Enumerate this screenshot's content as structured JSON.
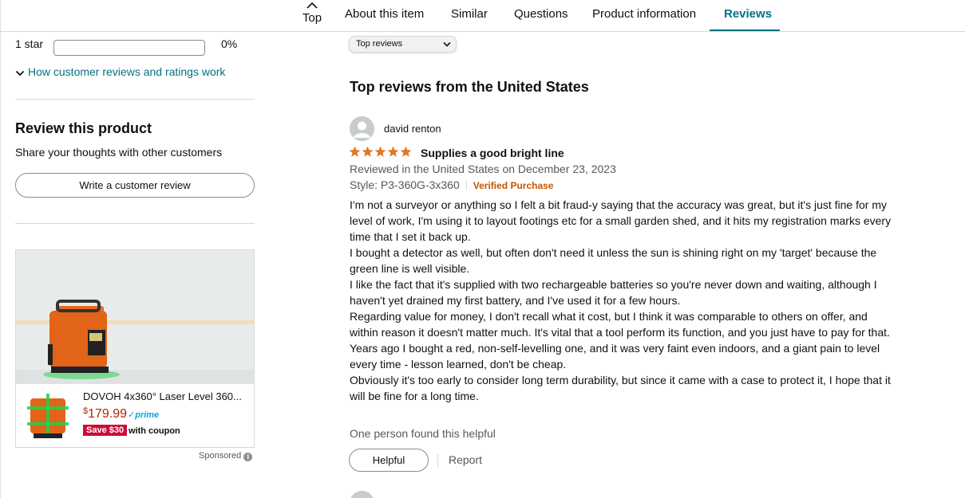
{
  "nav": {
    "top_label": "Top",
    "tabs": [
      {
        "label": "About this item"
      },
      {
        "label": "Similar"
      },
      {
        "label": "Questions"
      },
      {
        "label": "Product information"
      },
      {
        "label": "Reviews"
      }
    ],
    "active_tab": "Reviews",
    "accent_color": "#007185"
  },
  "ratings": {
    "one_star": {
      "label": "1 star",
      "percent_text": "0%",
      "fill_fraction": 0
    }
  },
  "how_link": "How customer reviews and ratings work",
  "review_product": {
    "title": "Review this product",
    "subtitle": "Share your thoughts with other customers",
    "button": "Write a customer review"
  },
  "ad": {
    "title": "DOVOH 4x360° Laser Level 360...",
    "price_symbol": "$",
    "price": "179.99",
    "prime": "prime",
    "save_badge": "Save $30",
    "coupon": "with coupon",
    "sponsored": "Sponsored",
    "save_color": "#cc0c39",
    "price_color": "#b12704"
  },
  "sort": {
    "selected": "Top reviews"
  },
  "section_title": "Top reviews from the United States",
  "review": {
    "author": "david renton",
    "rating": 5,
    "headline": "Supplies a good bright line",
    "date": "Reviewed in the United States on December 23, 2023",
    "style": "Style: P3-360G-3x360",
    "verified": "Verified Purchase",
    "body": [
      "I'm not a surveyor or anything so I felt a bit fraud-y saying that the accuracy was great, but it's just fine for my level of work, I'm using it to layout footings etc for a small garden shed, and it hits my registration marks every time that I set it back up.",
      "I bought a detector as well, but often don't need it unless the sun is shining right on my 'target' because the green line is well visible.",
      "I like the fact that it's supplied with two rechargeable batteries so you're never down and waiting, although I haven't yet drained my first battery, and I've used it for a few hours.",
      "Regarding value for money, I don't recall what it cost, but I think it was comparable to others on offer, and within reason it doesn't matter much. It's vital that a tool perform its function, and you just have to pay for that.",
      "Years ago I bought a red, non-self-levelling one, and it was very faint even indoors, and a giant pain to level every time - lesson learned, don't be cheap.",
      "Obviously it's too early to consider long term durability, but since it came with a case to protect it, I hope that it will be fine for a long time."
    ],
    "helpful_count": "One person found this helpful",
    "helpful_button": "Helpful",
    "report": "Report",
    "star_color": "#de7921",
    "verified_color": "#c45500"
  }
}
